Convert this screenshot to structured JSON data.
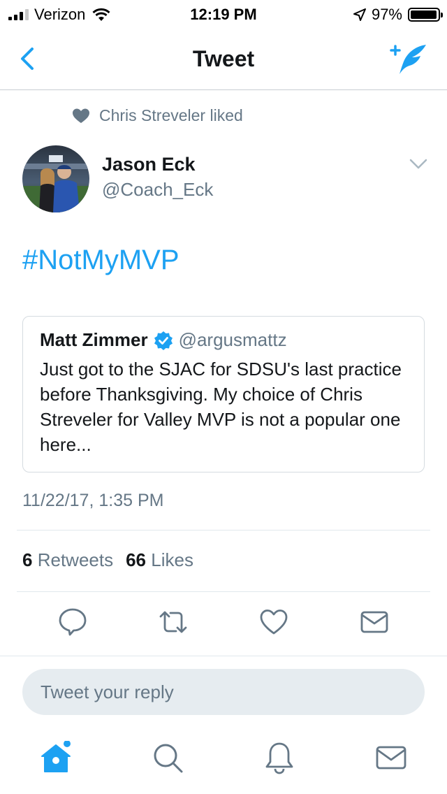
{
  "status_bar": {
    "carrier": "Verizon",
    "time": "12:19 PM",
    "battery": "97%",
    "battery_level": 0.97
  },
  "nav": {
    "title": "Tweet",
    "back_icon": "chevron-left-icon",
    "compose_icon": "compose-tweet-icon"
  },
  "context": {
    "text": "Chris Streveler liked",
    "icon": "heart-icon"
  },
  "tweet": {
    "author_name": "Jason Eck",
    "author_handle": "@Coach_Eck",
    "text": "#NotMyMVP",
    "timestamp": "11/22/17, 1:35 PM",
    "retweets_count": "6",
    "retweets_label": "Retweets",
    "likes_count": "66",
    "likes_label": "Likes"
  },
  "quoted": {
    "name": "Matt Zimmer",
    "handle": "@argusmattz",
    "text": "Just got to the SJAC for SDSU's last practice before Thanksgiving. My choice of Chris Streveler for Valley MVP is not a popular one here..."
  },
  "reply": {
    "placeholder": "Tweet your reply"
  },
  "colors": {
    "accent": "#1da1f2",
    "muted": "#657786",
    "divider": "#e1e8ed"
  }
}
